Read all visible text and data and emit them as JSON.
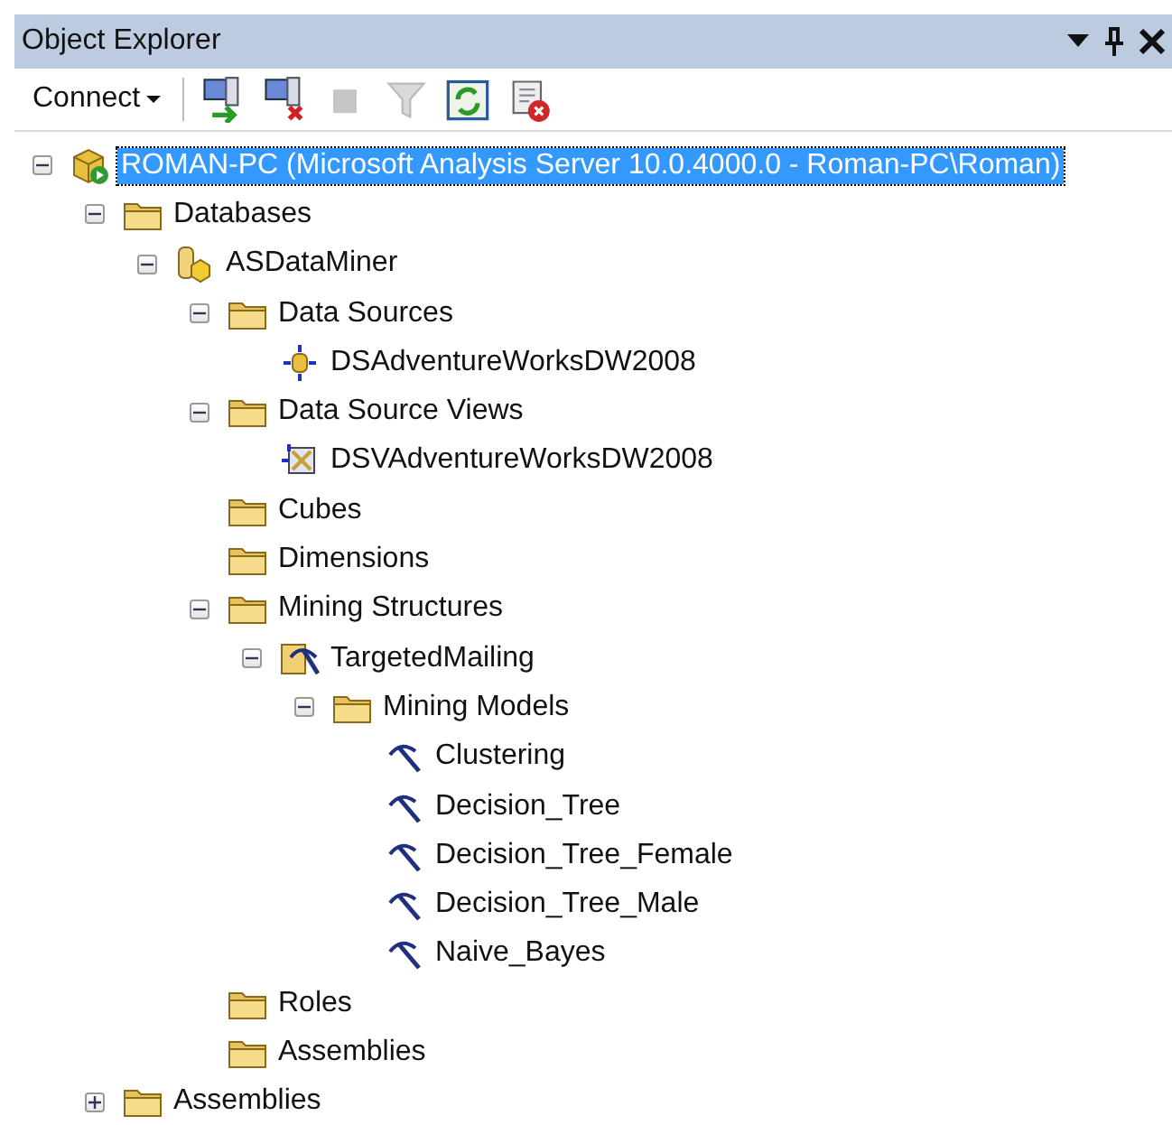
{
  "window": {
    "title": "Object Explorer"
  },
  "toolbar": [
    {
      "kind": "connect",
      "label": "Connect",
      "disabled": false
    },
    {
      "kind": "connect-object",
      "disabled": false
    },
    {
      "kind": "disconnect",
      "disabled": false
    },
    {
      "kind": "stop",
      "disabled": true
    },
    {
      "kind": "filter",
      "disabled": true
    },
    {
      "kind": "refresh",
      "disabled": false
    },
    {
      "kind": "stop-script",
      "disabled": false
    }
  ],
  "tree": [
    {
      "label": "ROMAN-PC (Microsoft Analysis Server 10.0.4000.0 - Roman-PC\\Roman)",
      "kind": "server",
      "expanded": true,
      "selected": true,
      "children": [
        {
          "label": "Databases",
          "kind": "folder",
          "expanded": true,
          "selected": false,
          "children": [
            {
              "label": "ASDataMiner",
              "kind": "database",
              "expanded": true,
              "selected": false,
              "children": [
                {
                  "label": "Data Sources",
                  "kind": "folder",
                  "expanded": true,
                  "selected": false,
                  "children": [
                    {
                      "label": "DSAdventureWorksDW2008",
                      "kind": "datasource",
                      "selected": false
                    }
                  ]
                },
                {
                  "label": "Data Source Views",
                  "kind": "folder",
                  "expanded": true,
                  "selected": false,
                  "children": [
                    {
                      "label": "DSVAdventureWorksDW2008",
                      "kind": "dsv",
                      "selected": false
                    }
                  ]
                },
                {
                  "label": "Cubes",
                  "kind": "folder",
                  "selected": false
                },
                {
                  "label": "Dimensions",
                  "kind": "folder",
                  "selected": false
                },
                {
                  "label": "Mining Structures",
                  "kind": "folder",
                  "expanded": true,
                  "selected": false,
                  "children": [
                    {
                      "label": "TargetedMailing",
                      "kind": "structure",
                      "expanded": true,
                      "selected": false,
                      "children": [
                        {
                          "label": "Mining Models",
                          "kind": "folder",
                          "expanded": true,
                          "selected": false,
                          "children": [
                            {
                              "label": "Clustering",
                              "kind": "model",
                              "selected": false
                            },
                            {
                              "label": "Decision_Tree",
                              "kind": "model",
                              "selected": false
                            },
                            {
                              "label": "Decision_Tree_Female",
                              "kind": "model",
                              "selected": false
                            },
                            {
                              "label": "Decision_Tree_Male",
                              "kind": "model",
                              "selected": false
                            },
                            {
                              "label": "Naive_Bayes",
                              "kind": "model",
                              "selected": false
                            }
                          ]
                        }
                      ]
                    }
                  ]
                },
                {
                  "label": "Roles",
                  "kind": "folder",
                  "selected": false
                },
                {
                  "label": "Assemblies",
                  "kind": "folder",
                  "selected": false
                }
              ]
            }
          ]
        },
        {
          "label": "Assemblies",
          "kind": "folder",
          "expanded": false,
          "selected": false
        }
      ]
    }
  ]
}
